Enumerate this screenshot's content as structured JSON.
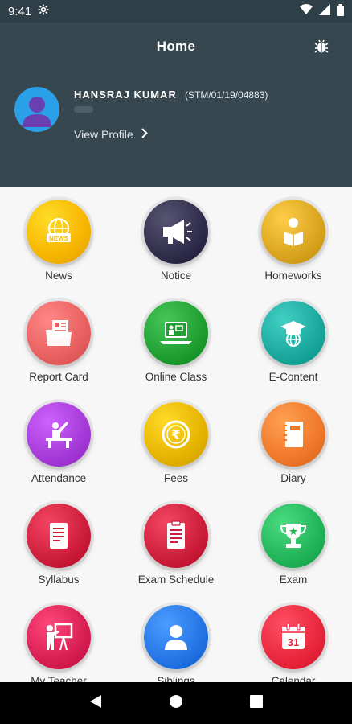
{
  "status_bar": {
    "time": "9:41"
  },
  "header": {
    "title": "Home"
  },
  "profile": {
    "name": "HANSRAJ  KUMAR",
    "id": "(STM/01/19/04883)",
    "view_profile": "View Profile"
  },
  "menu": [
    {
      "label": "News",
      "icon": "news-icon",
      "color": "#f7b500"
    },
    {
      "label": "Notice",
      "icon": "megaphone-icon",
      "color": "#2f2d4a"
    },
    {
      "label": "Homeworks",
      "icon": "reading-student-icon",
      "color": "#d9a520"
    },
    {
      "label": "Report Card",
      "icon": "report-folder-icon",
      "color": "#e8605f"
    },
    {
      "label": "Online Class",
      "icon": "laptop-teacher-icon",
      "color": "#1f9e31"
    },
    {
      "label": "E-Content",
      "icon": "graduation-globe-icon",
      "color": "#1aa89c"
    },
    {
      "label": "Attendance",
      "icon": "student-raise-hand-icon",
      "color": "#a63ad8"
    },
    {
      "label": "Fees",
      "icon": "rupee-coin-icon",
      "color": "#e5b300"
    },
    {
      "label": "Diary",
      "icon": "diary-icon",
      "color": "#f0782a"
    },
    {
      "label": "Syllabus",
      "icon": "document-icon",
      "color": "#cc1d3b"
    },
    {
      "label": "Exam Schedule",
      "icon": "schedule-document-icon",
      "color": "#cc1d3b"
    },
    {
      "label": "Exam",
      "icon": "trophy-icon",
      "color": "#23b45a"
    },
    {
      "label": "My Teacher",
      "icon": "teacher-board-icon",
      "color": "#d81f54"
    },
    {
      "label": "Siblings",
      "icon": "person-icon",
      "color": "#2474e5"
    },
    {
      "label": "Calendar",
      "icon": "calendar-icon",
      "color": "#e8263c"
    }
  ],
  "calendar_day": "31",
  "colors": {
    "header": "#37474f",
    "status_bar": "#2f3f47",
    "avatar": "#2aa0e8",
    "background": "#f7f7f7"
  }
}
